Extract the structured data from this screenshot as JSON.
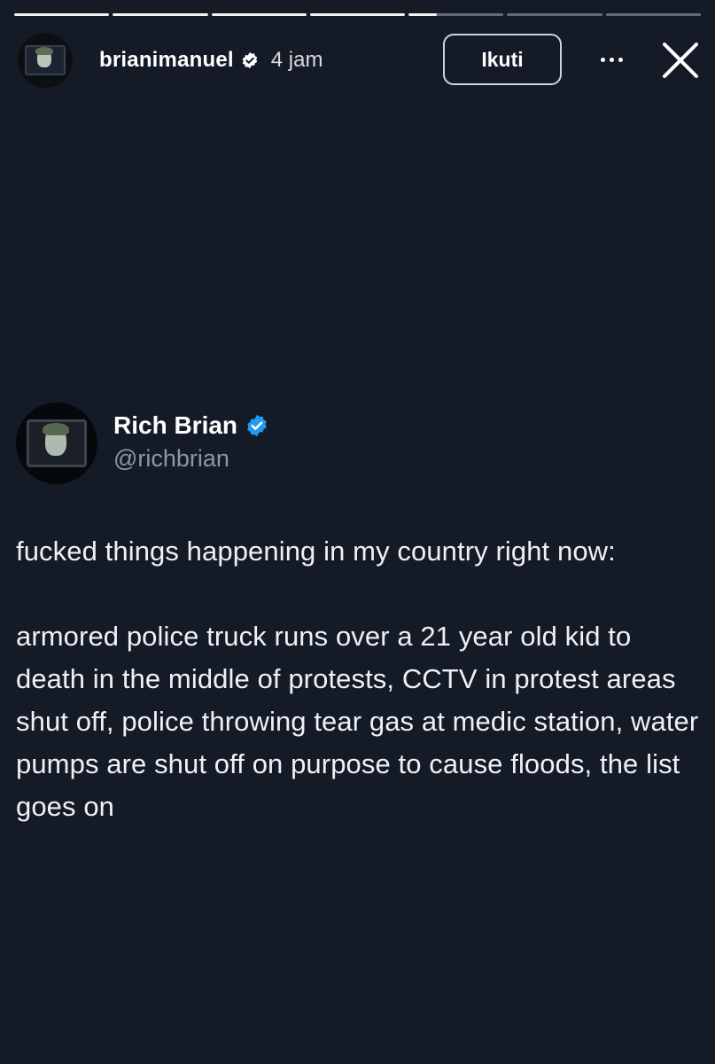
{
  "story": {
    "segments": 7,
    "active_segment_index": 4,
    "active_segment_progress": 0.3,
    "username": "brianimanuel",
    "verified_icon": "verified-badge-icon",
    "time_ago": "4 jam",
    "follow_label": "Ikuti",
    "more_icon": "more-options-icon",
    "close_icon": "close-icon"
  },
  "tweet": {
    "author_name": "Rich Brian",
    "handle": "@richbrian",
    "verified_icon": "verified-badge-icon",
    "paragraphs": [
      "fucked things happening in my country right now:",
      "armored police truck runs over a 21 year old kid to death in the middle of protests, CCTV in protest areas shut off, police throwing tear gas at medic station, water pumps are shut off on purpose to cause floods, the list goes on"
    ]
  },
  "colors": {
    "background": "#151b26",
    "verified_blue": "#1d9bf0",
    "handle_gray": "#8b98a5"
  }
}
